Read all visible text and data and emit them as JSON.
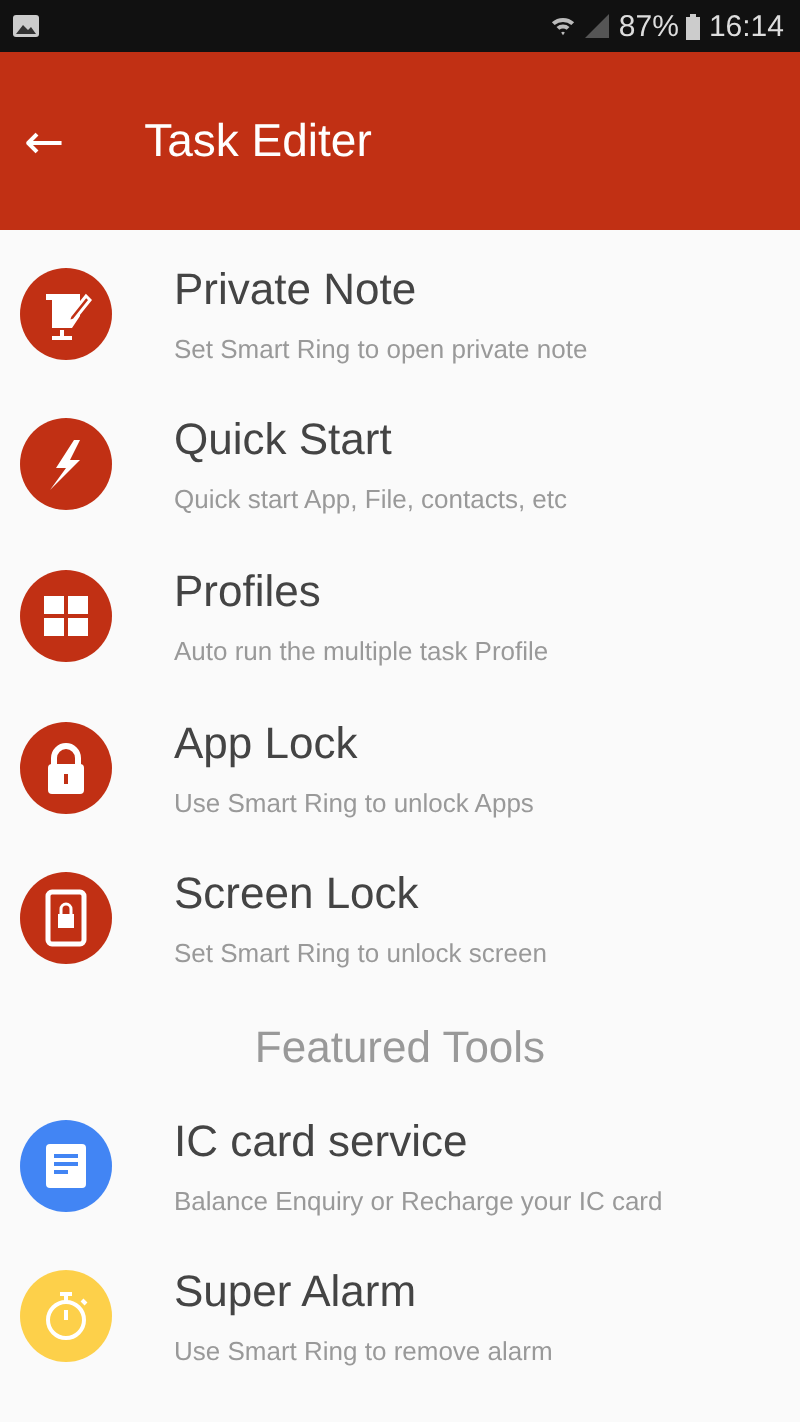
{
  "status_bar": {
    "battery": "87%",
    "time": "16:14"
  },
  "app_bar": {
    "back": "←",
    "title": "Task Editer"
  },
  "tasks": [
    {
      "kind": "note",
      "color": "#c13014",
      "title": "Private Note",
      "subtitle": "Set Smart Ring to open private note"
    },
    {
      "kind": "bolt",
      "color": "#c13014",
      "title": "Quick Start",
      "subtitle": "Quick start App, File, contacts, etc"
    },
    {
      "kind": "grid",
      "color": "#c13014",
      "title": "Profiles",
      "subtitle": "Auto run the multiple task Profile"
    },
    {
      "kind": "lock",
      "color": "#c13014",
      "title": "App Lock",
      "subtitle": "Use Smart Ring to unlock Apps"
    },
    {
      "kind": "tablet",
      "color": "#c13014",
      "title": "Screen Lock",
      "subtitle": "Set Smart Ring to unlock screen"
    }
  ],
  "featured": {
    "heading": "Featured Tools",
    "items": [
      {
        "kind": "card",
        "color": "#4285f4",
        "title": "IC card service",
        "subtitle": "Balance Enquiry or Recharge your IC card"
      },
      {
        "kind": "timer",
        "color": "#fdd04a",
        "title": "Super Alarm",
        "subtitle": "Use Smart Ring to remove alarm"
      }
    ]
  }
}
